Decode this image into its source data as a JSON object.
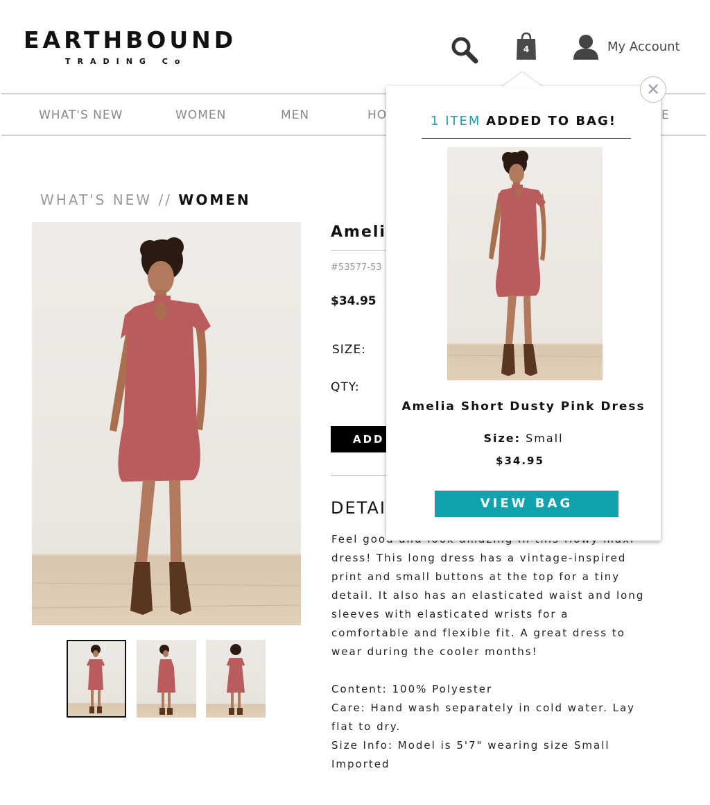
{
  "brand": {
    "name": "EARTHBOUND",
    "tagline": "TRADING Co"
  },
  "header": {
    "bag_count": "4",
    "account_label": "My Account"
  },
  "nav": {
    "items": [
      {
        "label": "WHAT'S NEW"
      },
      {
        "label": "WOMEN"
      },
      {
        "label": "MEN"
      },
      {
        "label": "HO"
      },
      {
        "label": "E"
      }
    ]
  },
  "breadcrumb": {
    "parent": "WHAT'S NEW",
    "separator": "//",
    "current": "WOMEN"
  },
  "product": {
    "title": "Amelia",
    "sku": "#53577-53",
    "price": "$34.95",
    "size_label": "SIZE:",
    "qty_label": "QTY:",
    "add_button": "ADD T",
    "details_heading": "DETAI",
    "description_lines": [
      "Feel good and look amazing in this flowy maxi",
      "dress! This long dress has a vintage-inspired",
      "print and small buttons at the top for a tiny",
      "detail. It also has an elasticated waist and long",
      "sleeves with elasticated wrists for a",
      "comfortable and flexible fit. A great dress to",
      "wear during the cooler months!",
      "",
      "Content: 100% Polyester",
      "Care: Hand wash separately in cold water.  Lay",
      "flat to dry.",
      "Size Info:  Model is 5'7\" wearing size Small",
      "Imported"
    ]
  },
  "popup": {
    "count_text": "1 ITEM",
    "added_text": "ADDED TO BAG!",
    "item_name": "Amelia Short Dusty Pink Dress",
    "size_label": "Size:",
    "size_value": "Small",
    "price": "$34.95",
    "view_bag_label": "VIEW BAG",
    "close_glyph": "✕"
  },
  "colors": {
    "accent": "#11a3ad",
    "dress": "#b95c5e"
  }
}
